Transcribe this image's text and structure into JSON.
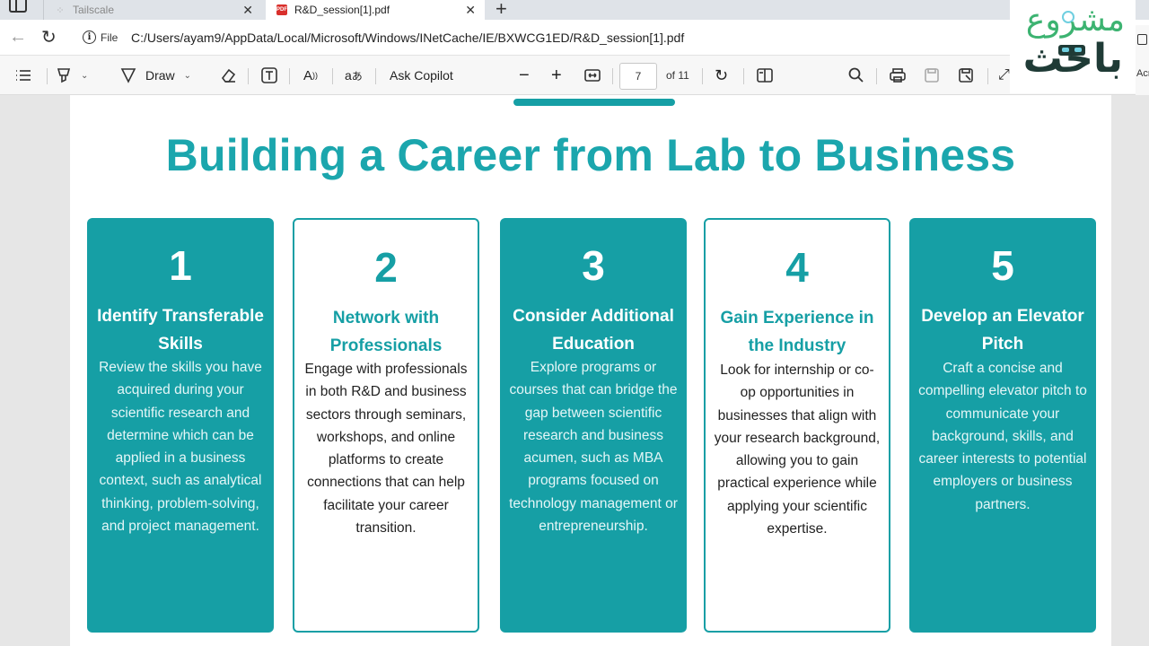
{
  "browser": {
    "tabs": [
      {
        "title": "Tailscale",
        "active": false
      },
      {
        "title": "R&D_session[1].pdf",
        "active": true
      }
    ],
    "address": {
      "scheme_label": "File",
      "url": "C:/Users/ayam9/AppData/Local/Microsoft/Windows/INetCache/IE/BXWCG1ED/R&D_session[1].pdf"
    }
  },
  "pdf_toolbar": {
    "draw_label": "Draw",
    "copilot_label": "Ask Copilot",
    "page_current": "7",
    "page_total_label": "of 11",
    "edge_label": "Acr"
  },
  "logo": {
    "line1": "مشروع",
    "line2": "باحث"
  },
  "slide": {
    "title": "Building a Career from Lab to Business",
    "cards": [
      {
        "number": "1",
        "title": "Identify Transferable Skills",
        "style": "filled",
        "body": "Review the skills you have acquired during your scientific research and determine which can be applied in a business context, such as analytical thinking, problem-solving, and project management."
      },
      {
        "number": "2",
        "title": "Network with Professionals",
        "style": "outline",
        "body": "Engage with professionals in both R&D and business sectors through seminars, workshops, and online platforms to create connections that can help facilitate your career transition."
      },
      {
        "number": "3",
        "title": "Consider Additional Education",
        "style": "filled",
        "body": "Explore programs or courses that can bridge the gap between scientific research and business acumen, such as MBA programs focused on technology management or entrepreneurship."
      },
      {
        "number": "4",
        "title": "Gain Experience in the Industry",
        "style": "outline",
        "body": "Look for internship or co-op opportunities in businesses that align with your research background, allowing you to gain practical experience while applying your scientific expertise."
      },
      {
        "number": "5",
        "title": "Develop an Elevator Pitch",
        "style": "filled",
        "body": "Craft a concise and compelling elevator pitch to communicate your background, skills, and career interests to potential employers or business partners."
      }
    ]
  },
  "colors": {
    "accent": "#169fa5",
    "title": "#1ba6ad"
  }
}
